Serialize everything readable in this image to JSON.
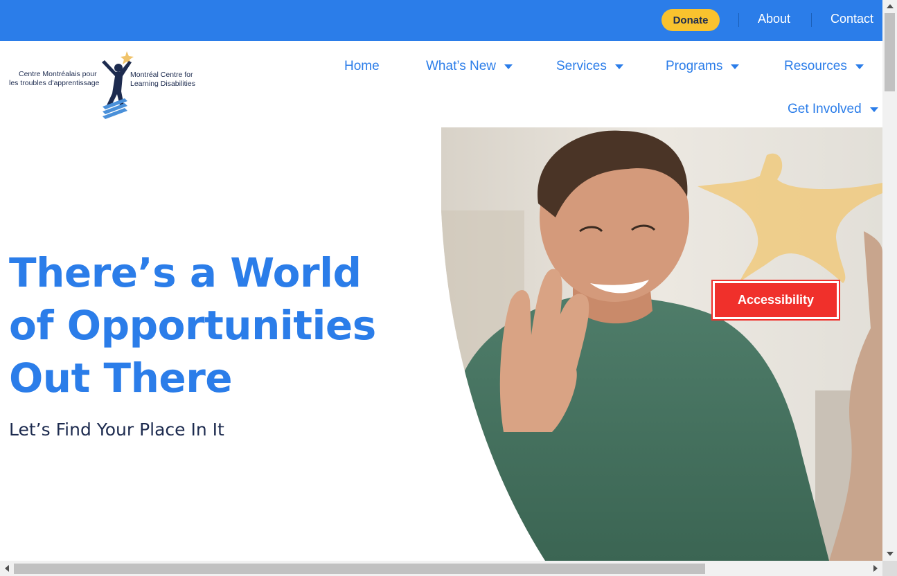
{
  "topbar": {
    "donate_label": "Donate",
    "links": [
      "About",
      "Contact"
    ],
    "bg_color": "#2b7de9"
  },
  "logo": {
    "fr_line1": "Centre Montréalais pour",
    "fr_line2": "les troubles d'apprentissage",
    "en_line1": "Montréal Centre for",
    "en_line2": "Learning Disabilities"
  },
  "nav": {
    "items": [
      {
        "label": "Home"
      },
      {
        "label": "What’s New"
      },
      {
        "label": "Services"
      },
      {
        "label": "Programs"
      },
      {
        "label": "Resources"
      },
      {
        "label": "Get Involved"
      }
    ]
  },
  "hero": {
    "title_lines": [
      "There’s a World",
      "of Opportunities",
      "Out There"
    ],
    "subtitle": "Let’s Find Your Place In It",
    "accent_color": "#2b7de9"
  },
  "accessibility": {
    "label": "Accessibility",
    "color": "#f0302b"
  }
}
